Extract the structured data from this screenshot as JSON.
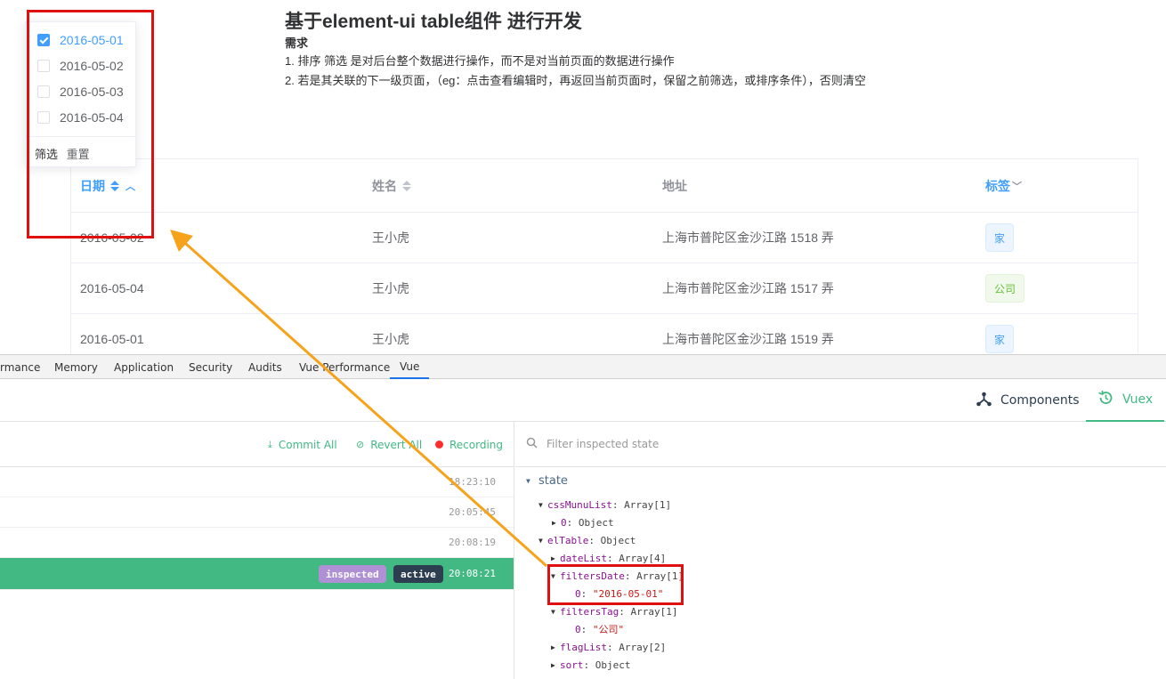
{
  "page": {
    "title": "基于element-ui table组件 进行开发",
    "req_heading": "需求",
    "req_line1": "1. 排序 筛选 是对后台整个数据进行操作，而不是对当前页面的数据进行操作",
    "req_line2": "2. 若是其关联的下一级页面，（eg：点击查看编辑时，再返回当前页面时，保留之前筛选，或排序条件），否则清空"
  },
  "table": {
    "headers": {
      "date": "日期",
      "name": "姓名",
      "address": "地址",
      "tag": "标签"
    },
    "filter_icon": "chevron-down-icon",
    "rows": [
      {
        "date": "2016-05-02",
        "name": "王小虎",
        "address": "上海市普陀区金沙江路 1518 弄",
        "tag": "家"
      },
      {
        "date": "2016-05-04",
        "name": "王小虎",
        "address": "上海市普陀区金沙江路 1517 弄",
        "tag": "公司"
      },
      {
        "date": "2016-05-01",
        "name": "王小虎",
        "address": "上海市普陀区金沙江路 1519 弄",
        "tag": "家"
      }
    ]
  },
  "filter_dropdown": {
    "options": [
      {
        "label": "2016-05-01",
        "checked": true
      },
      {
        "label": "2016-05-02",
        "checked": false
      },
      {
        "label": "2016-05-03",
        "checked": false
      },
      {
        "label": "2016-05-04",
        "checked": false
      }
    ],
    "confirm_label": "筛选",
    "reset_label": "重置"
  },
  "devtools": {
    "tabs": [
      "rmance",
      "Memory",
      "Application",
      "Security",
      "Audits",
      "Vue Performance",
      "Vue"
    ],
    "active_tab": "Vue",
    "vue_tabs": {
      "components": "Components",
      "vuex": "Vuex"
    },
    "actions": {
      "commit_all": "Commit All",
      "revert_all": "Revert All",
      "recording": "Recording"
    },
    "entries": [
      {
        "time": "18:23:10"
      },
      {
        "time": "20:05:45"
      },
      {
        "time": "20:08:19"
      },
      {
        "time": "20:08:21",
        "badges": [
          "inspected",
          "active"
        ]
      }
    ],
    "filter_placeholder": "Filter inspected state",
    "state": {
      "root": "state",
      "lines": [
        {
          "key": "cssMunuList",
          "value": ": Array[1]"
        },
        {
          "key": "0",
          "value": ": Object"
        },
        {
          "key": "elTable",
          "value": ": Object"
        },
        {
          "key": "dateList",
          "value": ": Array[4]"
        },
        {
          "key": "filtersDate",
          "value": ": Array[1]"
        },
        {
          "key": "0",
          "value": ": ",
          "str": "\"2016-05-01\""
        },
        {
          "key": "filtersTag",
          "value": ": Array[1]"
        },
        {
          "key": "0",
          "value": ": ",
          "str": "\"公司\""
        },
        {
          "key": "flagList",
          "value": ": Array[2]"
        },
        {
          "key": "sort",
          "value": ": Object"
        }
      ]
    }
  },
  "colors": {
    "primary": "#409eff",
    "vue_green": "#42b983",
    "annotation_red": "#e01010",
    "annotation_arrow": "#f7a21b"
  }
}
